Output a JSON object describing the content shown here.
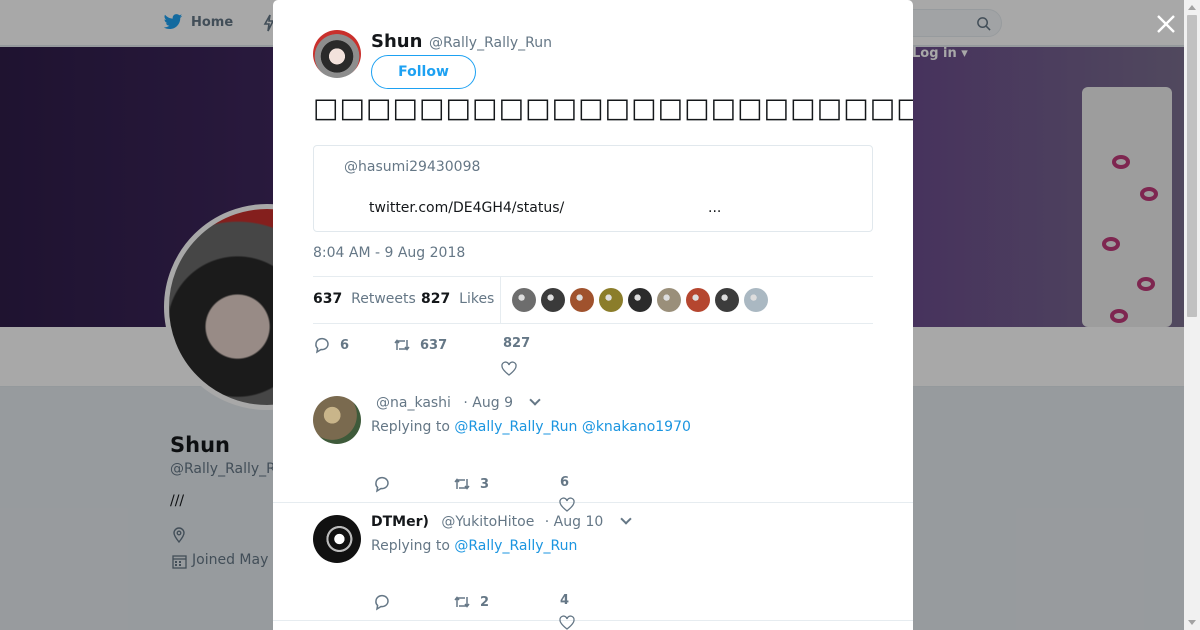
{
  "nav": {
    "home_label": "Home",
    "login_label": "Log in"
  },
  "profile": {
    "name": "Shun",
    "handle": "@Rally_Rally_R",
    "bio": "///",
    "joined": "Joined May"
  },
  "tweet": {
    "author_name": "Shun",
    "author_handle": "@Rally_Rally_Run",
    "follow_label": "Follow",
    "text": "□□□□□□□□□□□□□□□□□□□□□□□",
    "quote_handle": "@hasumi29430098",
    "quote_link": "twitter.com/DE4GH4/status/",
    "quote_ellipsis": "...",
    "timestamp": "8:04 AM - 9 Aug 2018",
    "retweets_count": "637",
    "retweets_label": "Retweets",
    "likes_count": "827",
    "likes_label": "Likes",
    "reply_count": "6",
    "retweet_action_count": "637",
    "like_action_count": "827",
    "liker_colors": [
      "#6d6d6d",
      "#3a3a3a",
      "#a0522d",
      "#8b7d2a",
      "#2b2b2b",
      "#9a8f7a",
      "#b5462f",
      "#3c3c3c",
      "#aab8c2"
    ]
  },
  "replies": [
    {
      "display_name": "",
      "handle": "@na_kashi",
      "time": "· Aug 9",
      "replying_prefix": "Replying to",
      "replying_to_1": "@Rally_Rally_Run",
      "replying_to_2": "@knakano1970",
      "reply_count": "",
      "retweet_count": "3",
      "like_count": "6",
      "avatar_color": "#7a6a4f"
    },
    {
      "display_name": "DTMer)",
      "handle": "@YukitoHitoe",
      "time": "· Aug 10",
      "replying_prefix": "Replying to",
      "replying_to_1": "@Rally_Rally_Run",
      "replying_to_2": "",
      "reply_count": "",
      "retweet_count": "2",
      "like_count": "4",
      "avatar_color": "#111111"
    }
  ]
}
